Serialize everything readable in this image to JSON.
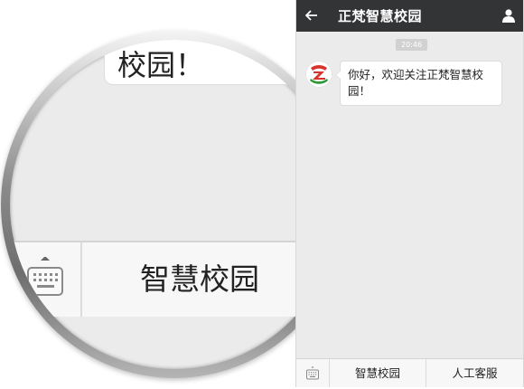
{
  "header": {
    "title": "正梵智慧校园"
  },
  "chat": {
    "time": "20:46",
    "message": "你好，欢迎关注正梵智慧校园！"
  },
  "bottom_menu": {
    "items": [
      "智慧校园",
      "人工客服"
    ]
  },
  "magnifier": {
    "bubble_text": "校园！",
    "menu_label": "智慧校园"
  },
  "colors": {
    "header_bg": "#333436",
    "screen_bg": "#ebebeb",
    "logo_red": "#d6342c",
    "logo_green": "#2f9a3c"
  }
}
